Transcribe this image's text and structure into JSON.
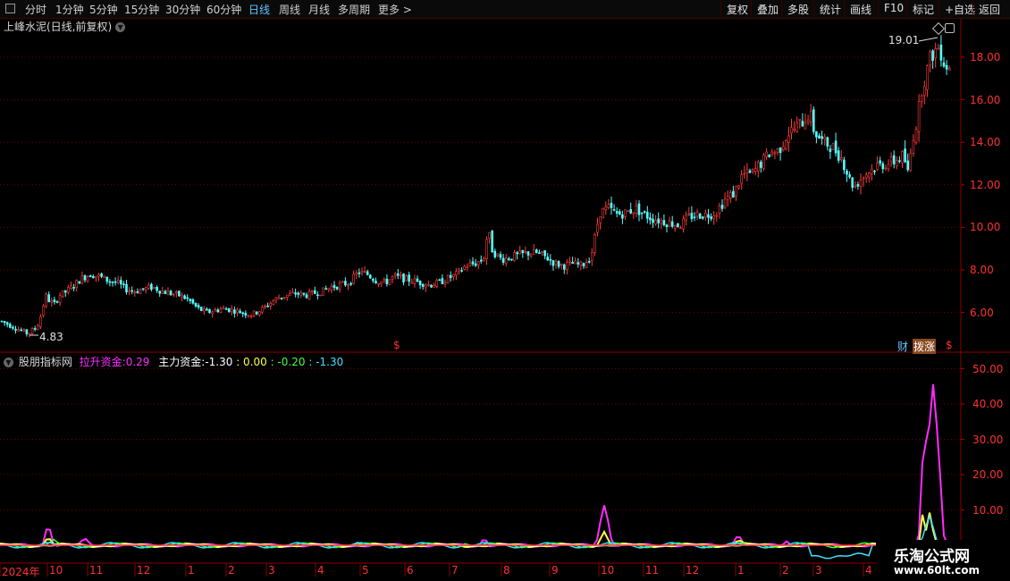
{
  "toolbar": {
    "periods": [
      "分时",
      "1分钟",
      "5分钟",
      "15分钟",
      "30分钟",
      "60分钟",
      "日线",
      "周线",
      "月线",
      "多周期",
      "更多 >"
    ],
    "active_period": "日线",
    "right_buttons": [
      "复权",
      "叠加",
      "多股",
      "统计",
      "画线",
      "F10",
      "标记",
      "+自选",
      "返回"
    ]
  },
  "main_chart": {
    "title": "上峰水泥(日线,前复权)",
    "y_ticks": [
      "18.00",
      "16.00",
      "14.00",
      "12.00",
      "10.00",
      "8.00",
      "6.00"
    ],
    "high_label": "19.01",
    "low_label": "4.83",
    "badges": {
      "cai": "财",
      "zhangting": "拨涨",
      "dollar": "$"
    }
  },
  "indicator": {
    "name": "股朋指标网",
    "label1": "拉升资金:",
    "value1": "0.29",
    "label2": "主力资金:",
    "value2": "-1.30",
    "value3": ": 0.00",
    "value4": ": -0.20",
    "value5": ": -1.30",
    "y_ticks": [
      "50.00",
      "40.00",
      "30.00",
      "20.00",
      "10.00"
    ],
    "colors": {
      "magenta": "#ff2bff",
      "yellow": "#ffff40",
      "green": "#40ff40",
      "cyan": "#40e0ff",
      "white": "#ffffff",
      "red": "#ff3030"
    }
  },
  "x_axis": {
    "labels": [
      "2024年",
      "10",
      "11",
      "12",
      "1",
      "2",
      "3",
      "4",
      "5",
      "6",
      "7",
      "8",
      "9",
      "10",
      "11",
      "12",
      "1",
      "2",
      "3",
      "4"
    ]
  },
  "watermark": {
    "line1": "乐淘公式网",
    "line2": "www.60lt.com"
  },
  "chart_data": {
    "type": "candlestick",
    "title": "上峰水泥(日线,前复权)",
    "ylim": [
      4.5,
      19.5
    ],
    "close_path": [
      [
        0,
        5.6
      ],
      [
        10,
        5.4
      ],
      [
        20,
        5.2
      ],
      [
        30,
        5.0
      ],
      [
        40,
        5.3
      ],
      [
        45,
        5.9
      ],
      [
        50,
        6.8
      ],
      [
        55,
        6.5
      ],
      [
        60,
        6.4
      ],
      [
        65,
        6.8
      ],
      [
        70,
        6.9
      ],
      [
        80,
        7.2
      ],
      [
        90,
        7.6
      ],
      [
        100,
        7.8
      ],
      [
        110,
        7.7
      ],
      [
        120,
        7.5
      ],
      [
        130,
        7.4
      ],
      [
        140,
        7.1
      ],
      [
        150,
        7.0
      ],
      [
        160,
        7.1
      ],
      [
        170,
        7.2
      ],
      [
        180,
        7.0
      ],
      [
        190,
        6.9
      ],
      [
        200,
        6.8
      ],
      [
        210,
        6.6
      ],
      [
        220,
        6.2
      ],
      [
        230,
        6.0
      ],
      [
        240,
        6.1
      ],
      [
        250,
        6.2
      ],
      [
        260,
        6.1
      ],
      [
        270,
        6.0
      ],
      [
        280,
        5.9
      ],
      [
        290,
        6.1
      ],
      [
        300,
        6.4
      ],
      [
        310,
        6.7
      ],
      [
        320,
        6.8
      ],
      [
        330,
        6.9
      ],
      [
        340,
        6.8
      ],
      [
        350,
        6.9
      ],
      [
        360,
        7.0
      ],
      [
        370,
        7.2
      ],
      [
        380,
        7.3
      ],
      [
        390,
        7.4
      ],
      [
        400,
        7.9
      ],
      [
        410,
        7.8
      ],
      [
        420,
        7.5
      ],
      [
        430,
        7.4
      ],
      [
        440,
        7.7
      ],
      [
        450,
        7.6
      ],
      [
        460,
        7.5
      ],
      [
        470,
        7.4
      ],
      [
        480,
        7.3
      ],
      [
        490,
        7.4
      ],
      [
        500,
        7.6
      ],
      [
        510,
        7.8
      ],
      [
        520,
        8.2
      ],
      [
        530,
        8.3
      ],
      [
        540,
        8.5
      ],
      [
        545,
        9.9
      ],
      [
        550,
        8.9
      ],
      [
        560,
        8.5
      ],
      [
        570,
        8.6
      ],
      [
        580,
        8.7
      ],
      [
        590,
        8.8
      ],
      [
        600,
        8.8
      ],
      [
        610,
        8.6
      ],
      [
        620,
        8.3
      ],
      [
        630,
        8.2
      ],
      [
        640,
        8.3
      ],
      [
        650,
        8.2
      ],
      [
        660,
        8.6
      ],
      [
        670,
        10.7
      ],
      [
        680,
        10.9
      ],
      [
        690,
        10.6
      ],
      [
        700,
        10.7
      ],
      [
        710,
        10.9
      ],
      [
        720,
        10.6
      ],
      [
        730,
        10.4
      ],
      [
        740,
        10.3
      ],
      [
        750,
        10.2
      ],
      [
        760,
        10.1
      ],
      [
        770,
        10.5
      ],
      [
        780,
        10.6
      ],
      [
        790,
        10.6
      ],
      [
        800,
        10.7
      ],
      [
        810,
        11.3
      ],
      [
        820,
        11.6
      ],
      [
        830,
        12.5
      ],
      [
        840,
        12.5
      ],
      [
        850,
        13.0
      ],
      [
        860,
        13.5
      ],
      [
        870,
        13.6
      ],
      [
        880,
        14.4
      ],
      [
        890,
        14.7
      ],
      [
        900,
        15.1
      ],
      [
        905,
        15.4
      ],
      [
        910,
        14.5
      ],
      [
        920,
        14.0
      ],
      [
        930,
        13.8
      ],
      [
        940,
        13.3
      ],
      [
        945,
        12.8
      ],
      [
        950,
        12.2
      ],
      [
        955,
        11.9
      ],
      [
        960,
        12.2
      ],
      [
        970,
        12.6
      ],
      [
        980,
        12.9
      ],
      [
        990,
        13.0
      ],
      [
        1000,
        13.1
      ],
      [
        1010,
        13.4
      ],
      [
        1015,
        12.5
      ],
      [
        1020,
        14.2
      ],
      [
        1025,
        15.0
      ],
      [
        1030,
        16.5
      ],
      [
        1035,
        17.2
      ],
      [
        1040,
        18.0
      ],
      [
        1045,
        18.3
      ],
      [
        1050,
        18.5
      ],
      [
        1055,
        17.8
      ],
      [
        1060,
        17.5
      ]
    ]
  }
}
